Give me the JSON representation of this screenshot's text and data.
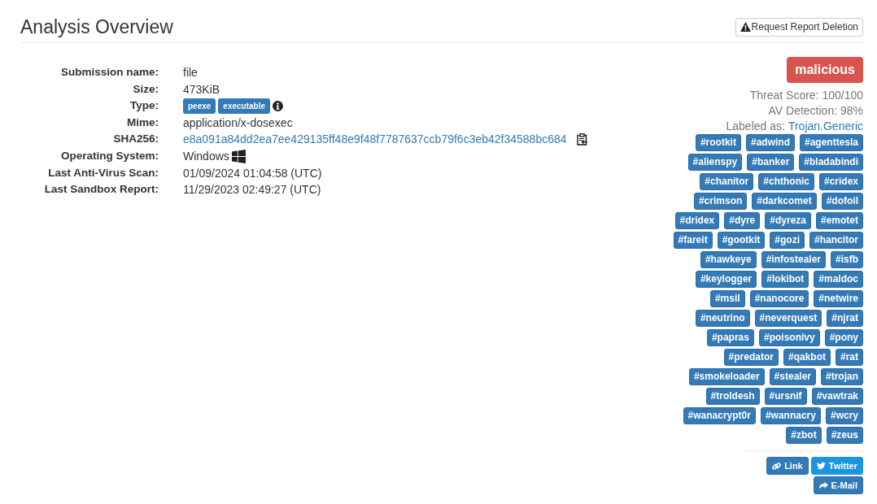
{
  "header": {
    "title": "Analysis Overview",
    "delete_button": "Request Report Deletion"
  },
  "details": [
    {
      "label": "Submission name:",
      "kind": "text",
      "value": "file"
    },
    {
      "label": "Size:",
      "kind": "text",
      "value": "473KiB"
    },
    {
      "label": "Type:",
      "kind": "badges",
      "badges": [
        "peexe",
        "executable"
      ]
    },
    {
      "label": "Mime:",
      "kind": "text",
      "value": "application/x-dosexec"
    },
    {
      "label": "SHA256:",
      "kind": "hash",
      "value": "e8a091a84dd2ea7ee429135ff48e9f48f7787637ccb79f6c3eb42f34588bc684"
    },
    {
      "label": "Operating System:",
      "kind": "os",
      "value": "Windows"
    },
    {
      "label": "Last Anti-Virus Scan:",
      "kind": "text",
      "value": "01/09/2024 01:04:58 (UTC)"
    },
    {
      "label": "Last Sandbox Report:",
      "kind": "text",
      "value": "11/29/2023 02:49:27 (UTC)"
    }
  ],
  "verdict": {
    "label": "malicious",
    "threat_score": "Threat Score: 100/100",
    "av_detection": "AV Detection: 98%",
    "labeled_as": "Labeled as:",
    "label_link": "Trojan.Generic"
  },
  "tags": [
    "#rootkit",
    "#adwind",
    "#agenttesla",
    "#alienspy",
    "#banker",
    "#bladabindi",
    "#chanitor",
    "#chthonic",
    "#cridex",
    "#crimson",
    "#darkcomet",
    "#dofoil",
    "#dridex",
    "#dyre",
    "#dyreza",
    "#emotet",
    "#fareit",
    "#gootkit",
    "#gozi",
    "#hancitor",
    "#hawkeye",
    "#infostealer",
    "#isfb",
    "#keylogger",
    "#lokibot",
    "#maldoc",
    "#msil",
    "#nanocore",
    "#netwire",
    "#neutrino",
    "#neverquest",
    "#njrat",
    "#papras",
    "#poisonivy",
    "#pony",
    "#predator",
    "#qakbot",
    "#rat",
    "#smokeloader",
    "#stealer",
    "#trojan",
    "#troldesh",
    "#ursnif",
    "#vawtrak",
    "#wanacrypt0r",
    "#wannacry",
    "#wcry",
    "#zbot",
    "#zeus"
  ],
  "share": [
    {
      "kind": "link",
      "label": "Link"
    },
    {
      "kind": "twitter",
      "label": "Twitter"
    },
    {
      "kind": "email",
      "label": "E-Mail"
    }
  ]
}
